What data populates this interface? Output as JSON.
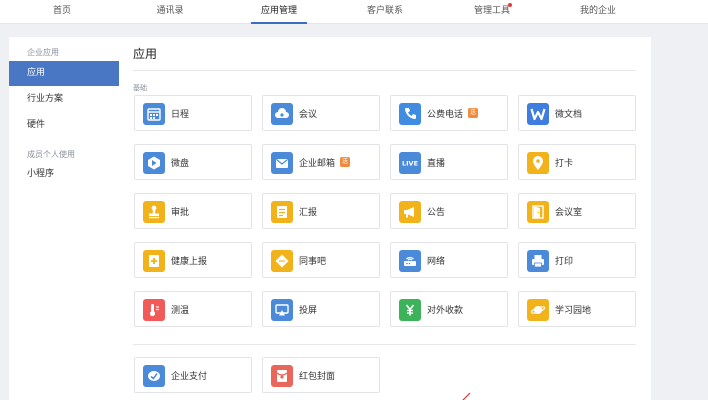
{
  "nav": {
    "items": [
      {
        "label": "首页"
      },
      {
        "label": "通讯录"
      },
      {
        "label": "应用管理"
      },
      {
        "label": "客户联系"
      },
      {
        "label": "管理工具"
      },
      {
        "label": "我的企业"
      }
    ],
    "active_index": 2
  },
  "sidebar": {
    "group1": "企业应用",
    "items1": [
      {
        "label": "应用"
      },
      {
        "label": "行业方案"
      },
      {
        "label": "硬件"
      }
    ],
    "group2": "成员个人使用",
    "items2": [
      {
        "label": "小程序"
      }
    ]
  },
  "main": {
    "title": "应用",
    "section": "基础",
    "apps": [
      {
        "label": "日程",
        "icon": "calendar-icon",
        "color": "#4a8ad8"
      },
      {
        "label": "会议",
        "icon": "cloud-meeting-icon",
        "color": "#4a8ad8"
      },
      {
        "label": "公费电话",
        "icon": "phone-icon",
        "color": "#3f8ce0",
        "badge": "送"
      },
      {
        "label": "微文档",
        "icon": "doc-w-icon",
        "color": "#3f7de0"
      },
      {
        "label": "微盘",
        "icon": "drive-icon",
        "color": "#4a8ad8"
      },
      {
        "label": "企业邮箱",
        "icon": "mail-icon",
        "color": "#4a8ad8",
        "badge": "送"
      },
      {
        "label": "直播",
        "icon": "live-icon",
        "color": "#4a8ad8",
        "icon_text": "LIVE"
      },
      {
        "label": "打卡",
        "icon": "location-pin-icon",
        "color": "#f2b31a"
      },
      {
        "label": "审批",
        "icon": "stamp-icon",
        "color": "#f2b31a"
      },
      {
        "label": "汇报",
        "icon": "report-icon",
        "color": "#f2b31a"
      },
      {
        "label": "公告",
        "icon": "megaphone-icon",
        "color": "#f2b31a"
      },
      {
        "label": "会议室",
        "icon": "door-icon",
        "color": "#f2b31a"
      },
      {
        "label": "健康上报",
        "icon": "health-report-icon",
        "color": "#f2b31a"
      },
      {
        "label": "同事吧",
        "icon": "diamond-chat-icon",
        "color": "#f2b31a"
      },
      {
        "label": "网络",
        "icon": "router-icon",
        "color": "#4a8ad8"
      },
      {
        "label": "打印",
        "icon": "printer-icon",
        "color": "#4a8ad8"
      },
      {
        "label": "测温",
        "icon": "thermometer-icon",
        "color": "#f25a5a"
      },
      {
        "label": "投屏",
        "icon": "screencast-icon",
        "color": "#4a8ad8"
      },
      {
        "label": "对外收款",
        "icon": "yuan-icon",
        "color": "#3cb35a"
      },
      {
        "label": "学习园地",
        "icon": "planet-icon",
        "color": "#f2b31a"
      }
    ],
    "apps2": [
      {
        "label": "企业支付",
        "icon": "pay-icon",
        "color": "#4a8ad8"
      },
      {
        "label": "红包封面",
        "icon": "red-envelope-icon",
        "color": "#e8675a"
      }
    ]
  }
}
